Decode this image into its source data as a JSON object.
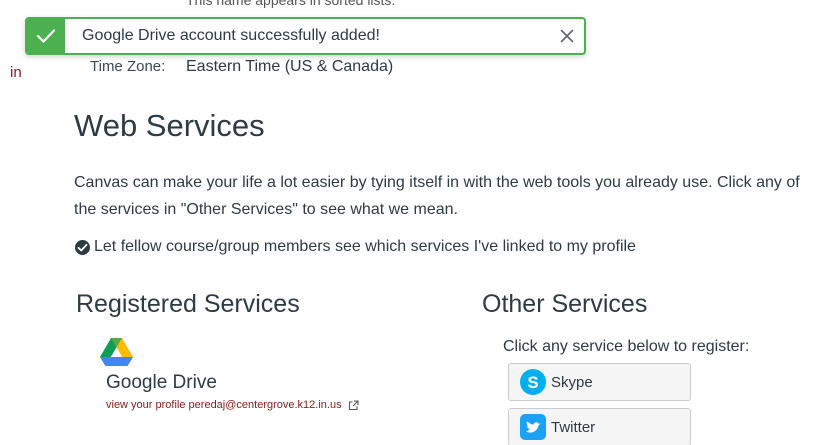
{
  "profile": {
    "cut_text": "This name appears in sorted lists.",
    "sidebar_fragment": "in",
    "timezone_label": "Time Zone:",
    "timezone_value": "Eastern Time (US & Canada)"
  },
  "toast": {
    "message": "Google Drive account successfully added!",
    "color": "#4caf50"
  },
  "web_services": {
    "title": "Web Services",
    "description": "Canvas can make your life a lot easier by tying itself in with the web tools you already use. Click any of the services in \"Other Services\" to see what we mean.",
    "share_label": "Let fellow course/group members see which services I've linked to my profile",
    "share_checked": true
  },
  "registered": {
    "title": "Registered Services",
    "services": [
      {
        "name": "Google Drive",
        "link_text": "view your profile",
        "account": "peredaj@centergrove.k12.in.us",
        "icon": "google-drive-icon"
      }
    ]
  },
  "other": {
    "title": "Other Services",
    "hint": "Click any service below to register:",
    "services": [
      {
        "name": "Skype",
        "icon": "skype-icon"
      },
      {
        "name": "Twitter",
        "icon": "twitter-icon"
      }
    ]
  },
  "colors": {
    "text": "#2d3b45",
    "link": "#8b1a1a",
    "success": "#4caf50",
    "skype": "#00aff0",
    "twitter": "#1da1f2"
  }
}
